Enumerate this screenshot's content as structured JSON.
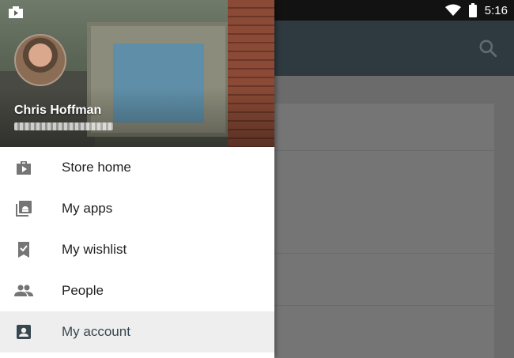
{
  "statusbar": {
    "time": "5:16",
    "wifi_icon": "wifi-icon",
    "battery_icon": "battery-icon"
  },
  "toolbar": {
    "search_icon": "search-icon"
  },
  "drawer": {
    "header_icon": "play-store-bag-icon",
    "user": {
      "name": "Chris Hoffman",
      "avatar": "avatar"
    },
    "items": [
      {
        "label": "Store home",
        "icon": "store-bag-icon",
        "selected": false
      },
      {
        "label": "My apps",
        "icon": "my-apps-icon",
        "selected": false
      },
      {
        "label": "My wishlist",
        "icon": "wishlist-bookmark-icon",
        "selected": false
      },
      {
        "label": "People",
        "icon": "people-icon",
        "selected": false
      },
      {
        "label": "My account",
        "icon": "account-icon",
        "selected": true
      }
    ]
  },
  "colors": {
    "toolbar": "#2e3a3f",
    "statusbar": "#121212",
    "selected_row": "#eeeeee",
    "scrim_content": "#6b6b6b"
  }
}
